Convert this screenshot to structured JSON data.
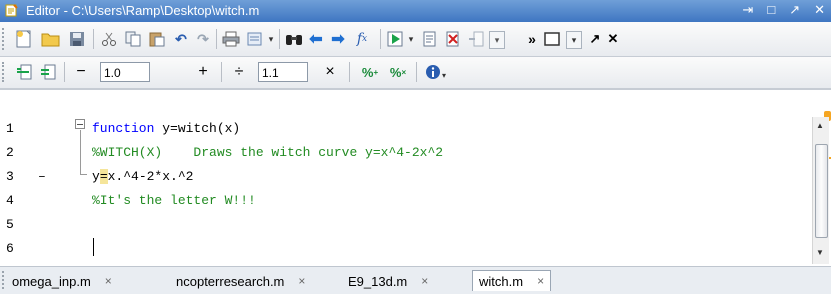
{
  "window": {
    "title": "Editor - C:\\Users\\Ramp\\Desktop\\witch.m",
    "controls": [
      "⇥",
      "□",
      "↗",
      "✕"
    ]
  },
  "toolbar1": {
    "overflow_label": "»"
  },
  "toolbar2": {
    "minus_label": "−",
    "step1_value": "1.0",
    "plus_label": "+",
    "divide_label": "÷",
    "step2_value": "1.1",
    "times_label": "×"
  },
  "editor": {
    "line_numbers": [
      "1",
      "2",
      "3",
      "4",
      "5",
      "6"
    ],
    "line3_marker": "–",
    "lines": {
      "l1_keyword": "function",
      "l1_rest": " y=witch(x)",
      "l2_comment": "%WITCH(X)    Draws the witch curve y=x^4-2x^2",
      "l3_pre": "y",
      "l3_hl": "=",
      "l3_post": "x.^4-2*x.^2",
      "l4_comment": "%It's the letter W!!!"
    }
  },
  "tabs": [
    {
      "label": "omega_inp.m",
      "close": "×"
    },
    {
      "label": "ncopterresearch.m",
      "close": "×"
    },
    {
      "label": "E9_13d.m",
      "close": "×"
    },
    {
      "label": "witch.m",
      "close": "×"
    }
  ],
  "colors": {
    "keyword": "#0000ff",
    "comment": "#228b22",
    "titlebar": "#4a7ec8"
  }
}
